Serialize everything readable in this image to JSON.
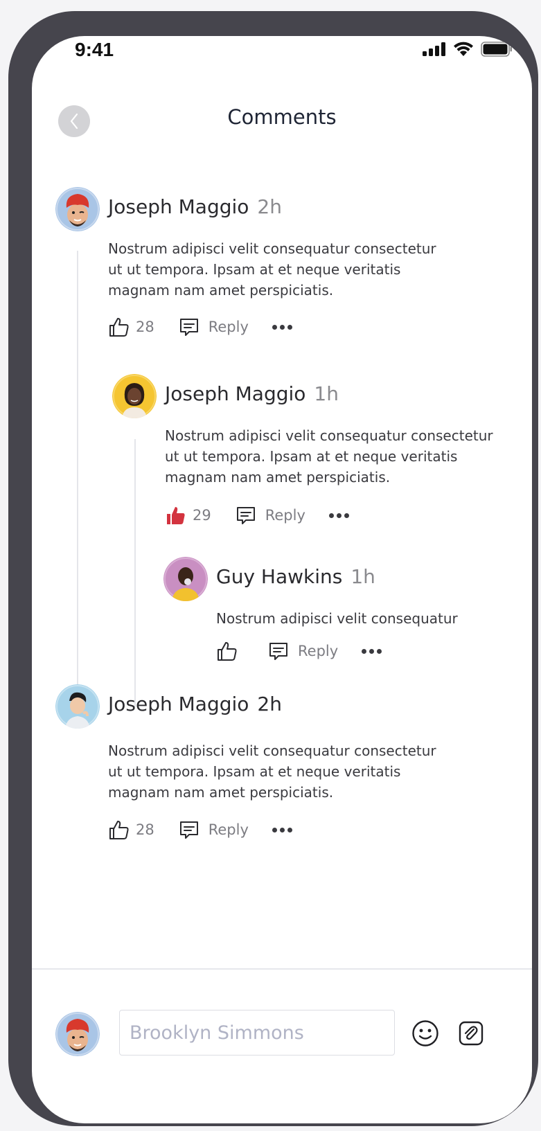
{
  "status_bar": {
    "time": "9:41"
  },
  "header": {
    "title": "Comments"
  },
  "comments": [
    {
      "author": "Joseph Maggio",
      "time": "2h",
      "text_lines": [
        "Nostrum adipisci velit consequatur consectetur",
        "ut ut tempora. Ipsam at et neque veritatis",
        "magnam nam amet perspiciatis."
      ],
      "likes": "28",
      "reply_label": "Reply",
      "liked": false
    },
    {
      "author": "Joseph Maggio",
      "time": "1h",
      "text_lines": [
        "Nostrum adipisci velit consequatur consectetur",
        "ut ut tempora. Ipsam at et neque veritatis",
        "magnam nam amet perspiciatis."
      ],
      "likes": "29",
      "reply_label": "Reply",
      "liked": true
    },
    {
      "author": "Guy Hawkins",
      "time": "1h",
      "text_lines": [
        "Nostrum adipisci velit consequatur"
      ],
      "likes": "",
      "reply_label": "Reply",
      "liked": false
    },
    {
      "author": "Joseph Maggio",
      "time": "2h",
      "text_lines": [
        "Nostrum adipisci velit consequatur consectetur",
        "ut ut tempora. Ipsam at et neque veritatis",
        "magnam nam amet perspiciatis."
      ],
      "likes": "28",
      "reply_label": "Reply",
      "liked": false
    }
  ],
  "composer": {
    "placeholder": "Brooklyn Simmons"
  },
  "colors": {
    "liked": "#d3333f",
    "thread_line": "#e4e5ea",
    "title": "#1f2535"
  }
}
